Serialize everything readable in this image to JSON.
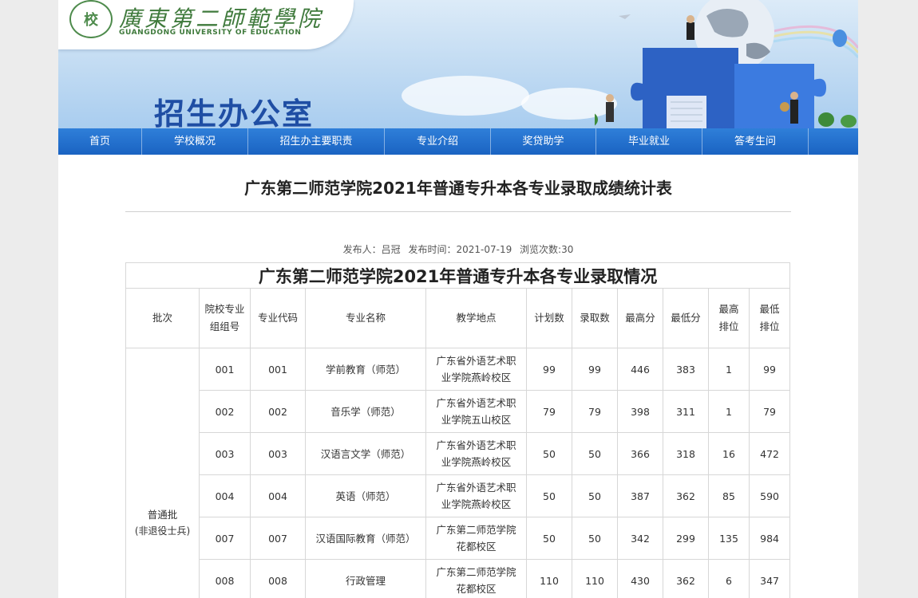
{
  "header": {
    "logo_cn": "廣東第二師範學院",
    "logo_en": "GUANGDONG UNIVERSITY OF EDUCATION",
    "office_title": "招生办公室"
  },
  "nav": [
    {
      "label": "首页"
    },
    {
      "label": "学校概况"
    },
    {
      "label": "招生办主要职责"
    },
    {
      "label": "专业介绍"
    },
    {
      "label": "奖贷助学"
    },
    {
      "label": "毕业就业"
    },
    {
      "label": "答考生问"
    }
  ],
  "article": {
    "title": "广东第二师范学院2021年普通专升本各专业录取成绩统计表",
    "publisher": "发布人：吕冠",
    "publish_time": "发布时间：2021-07-19",
    "views": "浏览次数:30"
  },
  "table": {
    "title": "广东第二师范学院2021年普通专升本各专业录取情况",
    "headers": [
      "批次",
      "院校专业组组号",
      "专业代码",
      "专业名称",
      "教学地点",
      "计划数",
      "录取数",
      "最高分",
      "最低分",
      "最高排位",
      "最低排位"
    ],
    "batch_name": "普通批",
    "batch_note": "(非退役士兵)",
    "rows": [
      {
        "group": "001",
        "code": "001",
        "major": "学前教育（师范）",
        "location": "广东省外语艺术职业学院燕岭校区",
        "plan": "99",
        "admitted": "99",
        "max": "446",
        "min": "383",
        "max_rank": "1",
        "min_rank": "99"
      },
      {
        "group": "002",
        "code": "002",
        "major": "音乐学（师范）",
        "location": "广东省外语艺术职业学院五山校区",
        "plan": "79",
        "admitted": "79",
        "max": "398",
        "min": "311",
        "max_rank": "1",
        "min_rank": "79"
      },
      {
        "group": "003",
        "code": "003",
        "major": "汉语言文学（师范）",
        "location": "广东省外语艺术职业学院燕岭校区",
        "plan": "50",
        "admitted": "50",
        "max": "366",
        "min": "318",
        "max_rank": "16",
        "min_rank": "472"
      },
      {
        "group": "004",
        "code": "004",
        "major": "英语（师范）",
        "location": "广东省外语艺术职业学院燕岭校区",
        "plan": "50",
        "admitted": "50",
        "max": "387",
        "min": "362",
        "max_rank": "85",
        "min_rank": "590"
      },
      {
        "group": "007",
        "code": "007",
        "major": "汉语国际教育（师范）",
        "location": "广东第二师范学院花都校区",
        "plan": "50",
        "admitted": "50",
        "max": "342",
        "min": "299",
        "max_rank": "135",
        "min_rank": "984"
      },
      {
        "group": "008",
        "code": "008",
        "major": "行政管理",
        "location": "广东第二师范学院花都校区",
        "plan": "110",
        "admitted": "110",
        "max": "430",
        "min": "362",
        "max_rank": "6",
        "min_rank": "347"
      }
    ]
  },
  "colors": {
    "nav_blue": "#1a63c2",
    "title_blue": "#1f4ea4",
    "logo_green": "#3f7a3c"
  }
}
